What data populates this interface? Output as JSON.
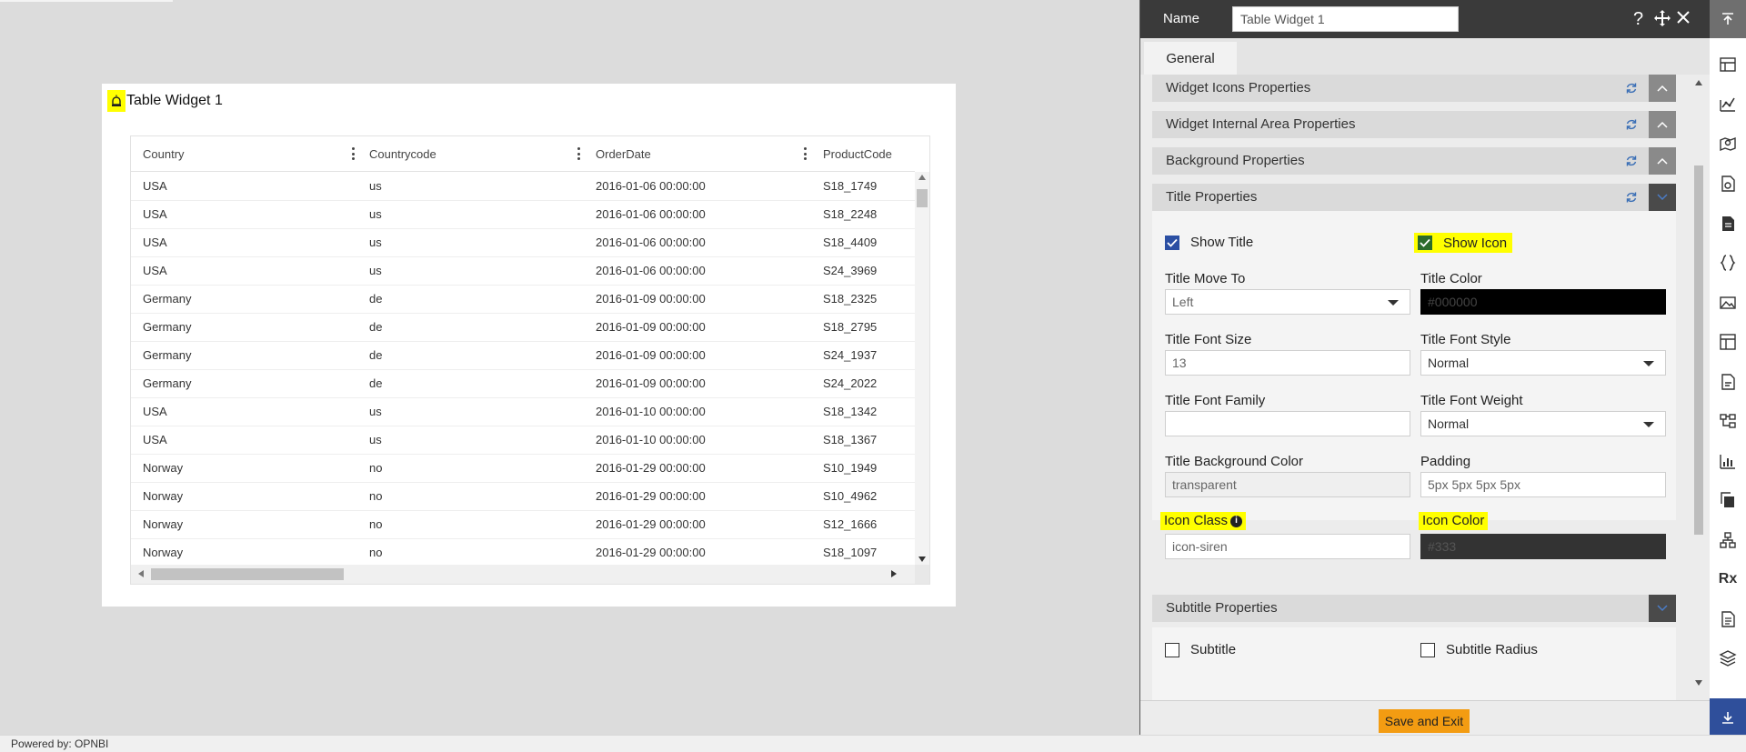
{
  "widget": {
    "title": "Table Widget 1",
    "icon": "siren-icon",
    "table": {
      "columns": [
        "Country",
        "Countrycode",
        "OrderDate",
        "ProductCode"
      ],
      "rows": [
        [
          "USA",
          "us",
          "2016-01-06 00:00:00",
          "S18_1749"
        ],
        [
          "USA",
          "us",
          "2016-01-06 00:00:00",
          "S18_2248"
        ],
        [
          "USA",
          "us",
          "2016-01-06 00:00:00",
          "S18_4409"
        ],
        [
          "USA",
          "us",
          "2016-01-06 00:00:00",
          "S24_3969"
        ],
        [
          "Germany",
          "de",
          "2016-01-09 00:00:00",
          "S18_2325"
        ],
        [
          "Germany",
          "de",
          "2016-01-09 00:00:00",
          "S18_2795"
        ],
        [
          "Germany",
          "de",
          "2016-01-09 00:00:00",
          "S24_1937"
        ],
        [
          "Germany",
          "de",
          "2016-01-09 00:00:00",
          "S24_2022"
        ],
        [
          "USA",
          "us",
          "2016-01-10 00:00:00",
          "S18_1342"
        ],
        [
          "USA",
          "us",
          "2016-01-10 00:00:00",
          "S18_1367"
        ],
        [
          "Norway",
          "no",
          "2016-01-29 00:00:00",
          "S10_1949"
        ],
        [
          "Norway",
          "no",
          "2016-01-29 00:00:00",
          "S10_4962"
        ],
        [
          "Norway",
          "no",
          "2016-01-29 00:00:00",
          "S12_1666"
        ],
        [
          "Norway",
          "no",
          "2016-01-29 00:00:00",
          "S18_1097"
        ]
      ]
    }
  },
  "panel": {
    "name_label": "Name",
    "name_value": "Table Widget 1",
    "header_icons": [
      "help-icon",
      "move-icon",
      "close-icon"
    ],
    "tab": "General",
    "sections": {
      "widget_icons": "Widget Icons Properties",
      "widget_internal": "Widget Internal Area Properties",
      "background": "Background Properties",
      "title": "Title Properties",
      "subtitle": "Subtitle Properties"
    },
    "title_props": {
      "show_title": {
        "label": "Show Title",
        "checked": true
      },
      "show_icon": {
        "label": "Show Icon",
        "checked": true
      },
      "move_to": {
        "label": "Title Move To",
        "value": "Left"
      },
      "color": {
        "label": "Title Color",
        "value": "#000000"
      },
      "font_size": {
        "label": "Title Font Size",
        "value": "13"
      },
      "font_style": {
        "label": "Title Font Style",
        "value": "Normal"
      },
      "font_family": {
        "label": "Title Font Family",
        "value": ""
      },
      "font_weight": {
        "label": "Title Font Weight",
        "value": "Normal"
      },
      "bg_color": {
        "label": "Title Background Color",
        "value": "transparent"
      },
      "padding": {
        "label": "Padding",
        "value": "5px 5px 5px 5px"
      },
      "icon_class": {
        "label": "Icon Class",
        "value": "icon-siren"
      },
      "icon_color": {
        "label": "Icon Color",
        "value": "#333"
      }
    },
    "subtitle_props": {
      "subtitle": {
        "label": "Subtitle",
        "checked": false
      },
      "radius": {
        "label": "Subtitle Radius",
        "checked": false
      }
    },
    "save_label": "Save and Exit",
    "highlight_color": "#ffff00",
    "accent_color": "#f39c12"
  },
  "rail": {
    "icons": [
      "scroll-top-icon",
      "table-icon",
      "line-chart-icon",
      "map-icon",
      "report-icon",
      "document-icon",
      "code-braces-icon",
      "image-icon",
      "layout-icon",
      "pdf-icon",
      "tree-icon",
      "bar-chart-icon",
      "copy-icon",
      "hierarchy-icon",
      "rx-icon",
      "file-icon",
      "layers-icon",
      "download-icon"
    ],
    "rx_text": "Rx"
  },
  "footer": {
    "text": "Powered by: OPNBI"
  }
}
